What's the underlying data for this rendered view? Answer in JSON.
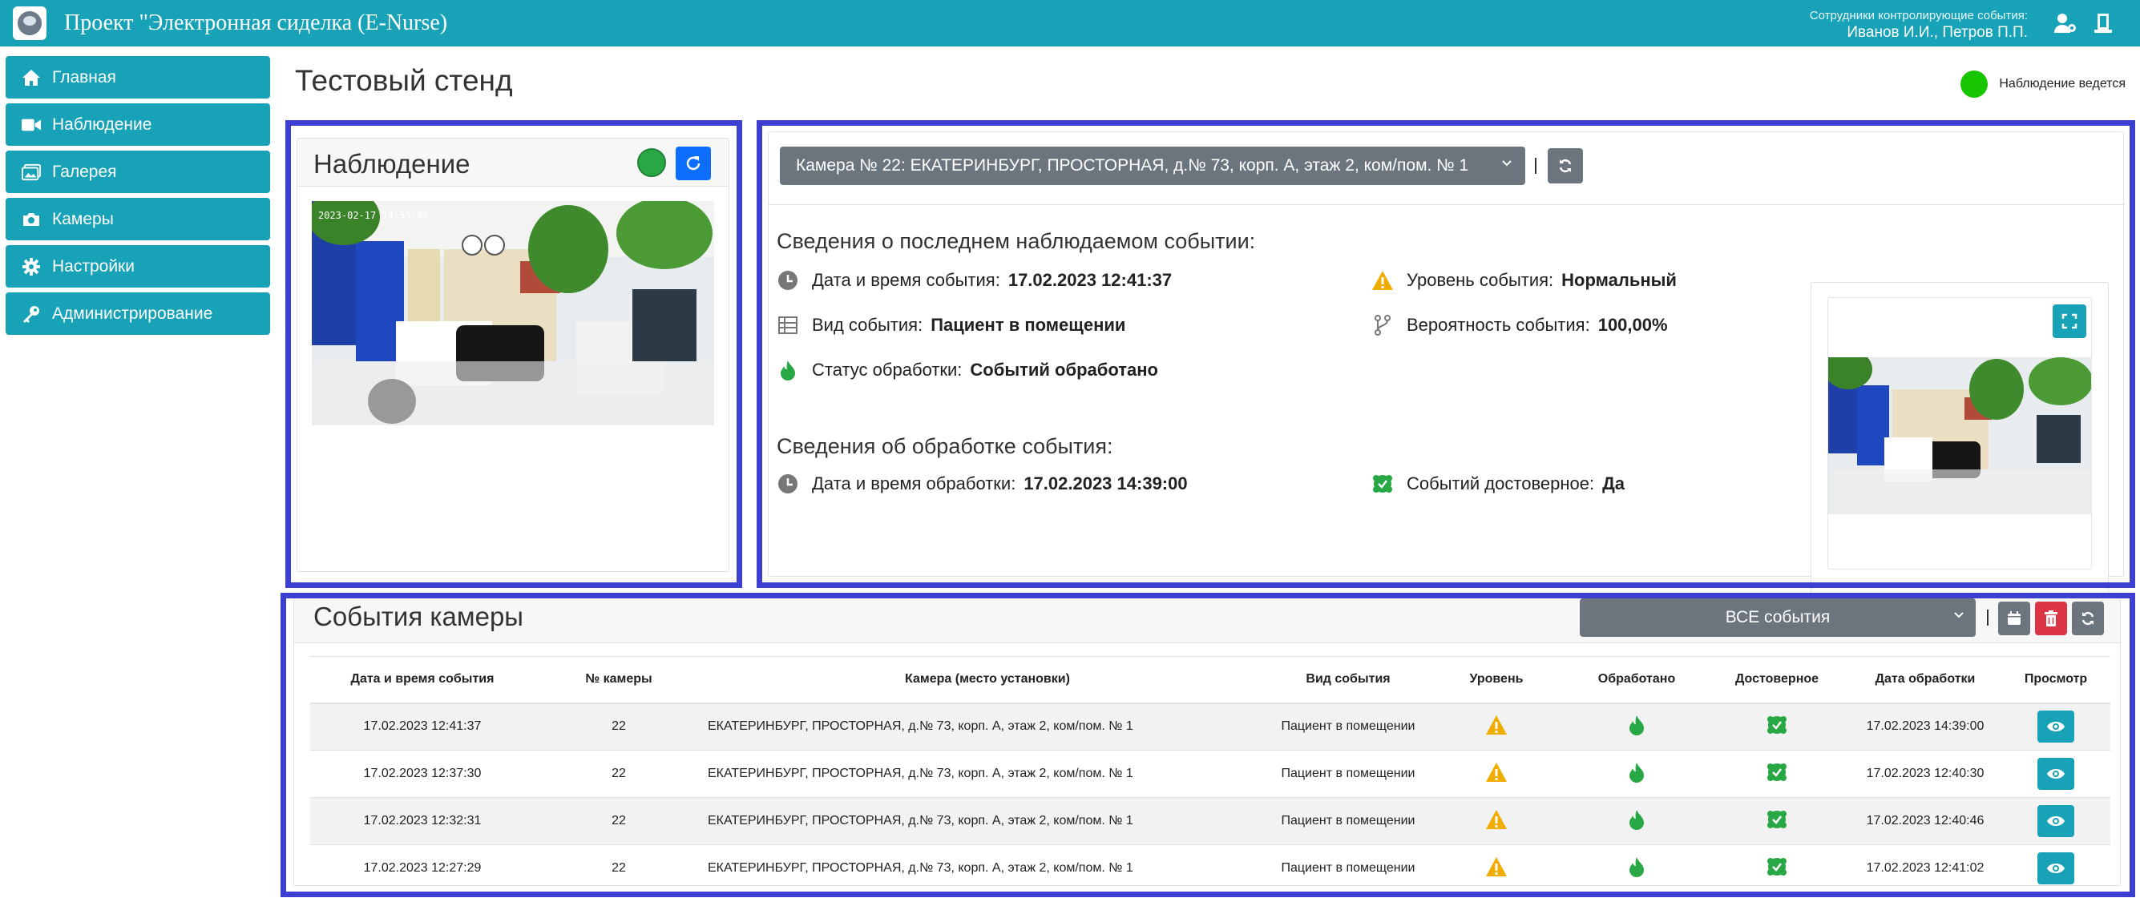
{
  "header": {
    "app_title": "Проект \"Электронная сиделка (E-Nurse)",
    "staff_label": "Сотрудники контролирующие события:",
    "staff_names": "Иванов И.И., Петров П.П."
  },
  "sidebar": {
    "items": [
      {
        "label": "Главная",
        "icon": "home-icon"
      },
      {
        "label": "Наблюдение",
        "icon": "video-icon"
      },
      {
        "label": "Галерея",
        "icon": "gallery-icon"
      },
      {
        "label": "Камеры",
        "icon": "camera-icon"
      },
      {
        "label": "Настройки",
        "icon": "gear-icon"
      },
      {
        "label": "Администрирование",
        "icon": "key-icon"
      }
    ]
  },
  "page": {
    "title": "Тестовый стенд",
    "status_text": "Наблюдение ведется",
    "status_color": "#17c600"
  },
  "observation": {
    "title": "Наблюдение",
    "timestamp": "2023-02-17 14:55:09"
  },
  "event_details": {
    "camera_select": "Камера № 22: ЕКАТЕРИНБУРГ, ПРОСТОРНАЯ, д.№ 73, корп. А, этаж 2, ком/пом. № 1",
    "last_event_heading": "Сведения о последнем наблюдаемом событии:",
    "event_datetime_label": "Дата и время события:",
    "event_datetime_value": "17.02.2023 12:41:37",
    "event_type_label": "Вид события:",
    "event_type_value": "Пациент в помещении",
    "processing_status_label": "Статус обработки:",
    "processing_status_value": "Событий обработано",
    "level_label": "Уровень события:",
    "level_value": "Нормальный",
    "probability_label": "Вероятность события:",
    "probability_value": "100,00%",
    "processing_heading": "Сведения об обработке события:",
    "processing_datetime_label": "Дата и время обработки:",
    "processing_datetime_value": "17.02.2023 14:39:00",
    "reliable_label": "Событий достоверное:",
    "reliable_value": "Да"
  },
  "events": {
    "title": "События камеры",
    "filter_select": "ВСЕ события",
    "columns": [
      "Дата и время события",
      "№ камеры",
      "Камера (место установки)",
      "Вид события",
      "Уровень",
      "Обработано",
      "Достоверное",
      "Дата обработки",
      "Просмотр"
    ],
    "rows": [
      {
        "datetime": "17.02.2023 12:41:37",
        "camera": "22",
        "location": "ЕКАТЕРИНБУРГ, ПРОСТОРНАЯ, д.№ 73, корп. А, этаж 2, ком/пом. № 1",
        "type": "Пациент в помещении",
        "processed_date": "17.02.2023 14:39:00"
      },
      {
        "datetime": "17.02.2023 12:37:30",
        "camera": "22",
        "location": "ЕКАТЕРИНБУРГ, ПРОСТОРНАЯ, д.№ 73, корп. А, этаж 2, ком/пом. № 1",
        "type": "Пациент в помещении",
        "processed_date": "17.02.2023 12:40:30"
      },
      {
        "datetime": "17.02.2023 12:32:31",
        "camera": "22",
        "location": "ЕКАТЕРИНБУРГ, ПРОСТОРНАЯ, д.№ 73, корп. А, этаж 2, ком/пом. № 1",
        "type": "Пациент в помещении",
        "processed_date": "17.02.2023 12:40:46"
      },
      {
        "datetime": "17.02.2023 12:27:29",
        "camera": "22",
        "location": "ЕКАТЕРИНБУРГ, ПРОСТОРНАЯ, д.№ 73, корп. А, этаж 2, ком/пом. № 1",
        "type": "Пациент в помещении",
        "processed_date": "17.02.2023 12:41:02"
      }
    ]
  },
  "colors": {
    "primary_teal": "#17a2b8",
    "frame_blue": "#3c3fd0",
    "warning": "#f0ad00",
    "success": "#28a745",
    "danger": "#dc3545"
  }
}
